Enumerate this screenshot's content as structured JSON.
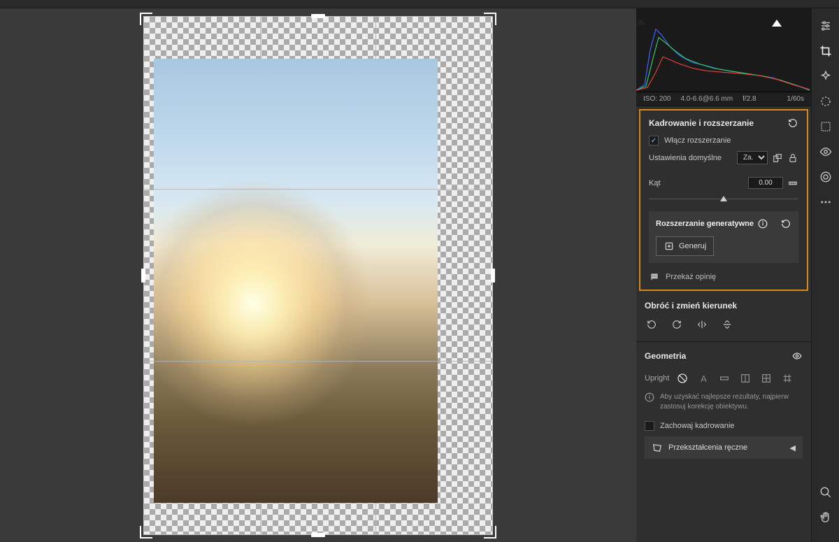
{
  "histogram_triangles": true,
  "meta": {
    "iso": "ISO: 200",
    "lens": "4.0-6.6@6.6 mm",
    "aperture": "f/2.8",
    "shutter": "1/60s"
  },
  "crop_panel": {
    "title": "Kadrowanie i rozszerzanie",
    "expand_toggle": "Włącz rozszerzanie",
    "expand_enabled": true,
    "preset_label": "Ustawienia domyślne",
    "preset_value": "Za...",
    "angle_label": "Kąt",
    "angle_value": "0.00",
    "generative_title": "Rozszerzanie generatywne",
    "generate_btn": "Generuj",
    "feedback": "Przekaż opinię"
  },
  "rotate_panel": {
    "title": "Obróć i zmień kierunek"
  },
  "geometry_panel": {
    "title": "Geometria",
    "upright_label": "Upright",
    "tip": "Aby uzyskać najlepsze rezultaty, najpierw zastosuj korekcję obiektywu.",
    "keep_crop": "Zachowaj kadrowanie",
    "manual": "Przekształcenia ręczne"
  },
  "toolbar": {
    "items": [
      "sliders",
      "crop",
      "healing",
      "mask",
      "eye",
      "rating",
      "dots"
    ],
    "bottom": [
      "zoom",
      "hand"
    ]
  }
}
